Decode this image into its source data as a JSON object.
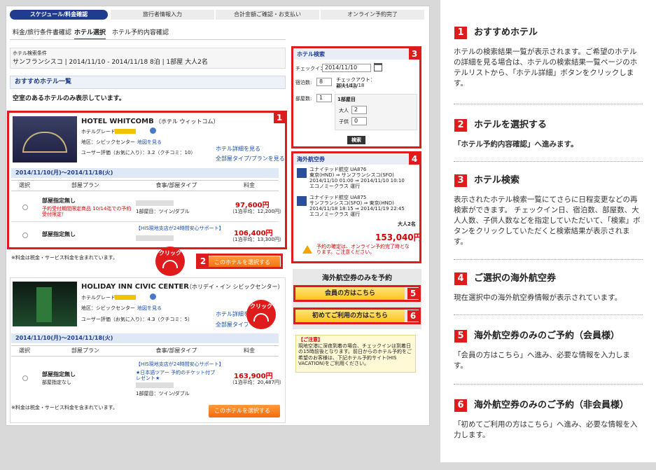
{
  "steps": [
    "スケジュール/料金確認",
    "旅行者情報入力",
    "合計金額ご確認・お支払い",
    "オンライン予約完了"
  ],
  "subtabs": [
    "料金/旅行条件書確認",
    "ホテル選択",
    "ホテル予約内容確認"
  ],
  "search_cond": {
    "label": "ホテル検索条件",
    "value": "サンフランシスコ | 2014/11/10 - 2014/11/18 8泊 | 1部屋 大人2名"
  },
  "recommend": {
    "title": "おすすめホテル一覧",
    "note": "空室のあるホテルのみ表示しています。"
  },
  "hotel1": {
    "name": "HOTEL WHITCOMB",
    "kana": "（ホテル ウィットコム）",
    "grade_label": "ホテルグレード：",
    "area": "地区：シビックセンター",
    "map_link": "地図を見る",
    "review": "ユーザー評価（お気に入り）：3.2（クチコミ：10）",
    "details_link": "ホテル詳細を見る",
    "plans_link": "全部屋タイプ/プランを見る",
    "date": "2014/11/10(月)〜2014/11/18(火)",
    "cols": [
      "選択",
      "部屋プラン",
      "食事/部屋タイプ",
      "料金"
    ],
    "rows": [
      {
        "plan": "部屋指定無し",
        "sub": "予約受付期間限定商品 10/14迄での予約受付限定！",
        "meal": "1部屋目：ツイン/ダブル",
        "price": "97,600円",
        "avg": "（1泊平均：12,200円）"
      },
      {
        "plan": "部屋指定無し",
        "sub": "",
        "meal": "【HIS現地支店が24時間安心サポート】",
        "price": "106,400円",
        "avg": "（1泊平均：13,300円）"
      }
    ],
    "tax_note": "※料金は税金・サービス料金を含まれています。",
    "select_btn": "このホテルを選択する"
  },
  "hotel2": {
    "name": "HOLIDAY INN CIVIC CENTER",
    "kana": "（ホリデイ・イン シビックセンター）",
    "grade_label": "ホテルグレード：",
    "area": "地区：シビックセンター",
    "map_link": "地図を見る",
    "review": "ユーザー評価（お気に入り）：4.3（クチコミ：5）",
    "details_link": "ホテル詳細を見る",
    "plans_link": "全部屋タイプ/プランを見る",
    "date": "2014/11/10(月)〜2014/11/18(火)",
    "cols": [
      "選択",
      "部屋プラン",
      "食事/部屋タイプ",
      "料金"
    ],
    "row": {
      "plan": "部屋指定無し",
      "sub": "部屋指定なし",
      "meal": "【HIS現地支店が24時間安心サポート】",
      "meal2": "★日本語ツアー 予約のチケット付プレゼント★",
      "meal3": "1部屋目：ツイン/ダブル",
      "price": "163,900円",
      "avg": "（1泊平均：20,487円）"
    },
    "tax_note": "※料金は税金・サービス料金を含まれています。",
    "select_btn": "このホテルを選択する"
  },
  "search_box": {
    "title": "ホテル検索",
    "checkin_label": "チェックイン:",
    "checkin_value": "2014/11/10",
    "nights_label": "宿泊数:",
    "nights_value": "8",
    "checkout": "チェックアウト： 2014/11/18",
    "checkout2": "最大14泊",
    "rooms_label": "部屋数:",
    "rooms_value": "1",
    "room1": "1部屋目",
    "adult_label": "大人",
    "adult_value": "2",
    "child_label": "子供",
    "child_value": "0",
    "search_btn": "検索"
  },
  "air": {
    "title": "海外航空券",
    "flight1": [
      "ユナイテッド航空 UA876",
      "東京(HND) ⇒ サンフランシスコ(SFO)",
      "2014/11/10 01:00 ⇒ 2014/11/10 10:10",
      "エコノミークラス 運行"
    ],
    "flight2": [
      "ユナイテッド航空 UA875",
      "サンフランシスコ(SFO) ⇒ 東京(HND)",
      "2014/11/18 18:15 ⇒ 2014/11/19 22:45",
      "エコノミークラス 運行"
    ],
    "pax": "大人2名",
    "price": "153,040円",
    "warn": "予約の確定は、オンライン予約完了時となります。ご注意ください。"
  },
  "aironly": {
    "title": "海外航空券のみを予約",
    "member_btn": "会員の方はこちら",
    "first_btn": "初めてご利用の方はこちら"
  },
  "notice": {
    "head": "【ご注意】",
    "text": "現地空港に深夜到着の場合、チェックインは到着日の15時前後となります。前日からのホテル予約をご希望のお客様は、下記ホテル予約サイト(HIS VACATION)をご利用ください。"
  },
  "click_label": "クリック",
  "markers": [
    "1",
    "2",
    "3",
    "4",
    "5",
    "6"
  ],
  "right": [
    {
      "num": "1",
      "title": "おすすめホテル",
      "desc": "ホテルの検索結果一覧が表示されます。ご希望のホテルの詳細を見る場合は、ホテルの検索結果一覧ページのホテルリストから、「ホテル詳細」ボタンをクリックします。"
    },
    {
      "num": "2",
      "title": "ホテルを選択する",
      "desc": "「ホテル予約内容確認」へ進みます。"
    },
    {
      "num": "3",
      "title": "ホテル検索",
      "desc": "表示されたホテル検索一覧にてさらに日程変更などの再検索ができます。 チェックイン日、宿泊数、部屋数、大人人数、子供人数などを指定していただいて、「検索」ボタンをクリックしていただくと検索結果が表示されます。"
    },
    {
      "num": "4",
      "title": "ご選択の海外航空券",
      "desc": "現在選択中の海外航空券情報が表示されています。"
    },
    {
      "num": "5",
      "title": "海外航空券のみのご予約（会員様）",
      "desc": "「会員の方はこちら」へ進み、必要な情報を入力します。"
    },
    {
      "num": "6",
      "title": "海外航空券のみのご予約（非会員様）",
      "desc": "「初めてご利用の方はこちら」へ進み、必要な情報を入力します。"
    }
  ],
  "colors": {
    "accent": "#e01b1b",
    "navy": "#1f3c8f",
    "orange": "#f26a0d",
    "yellow": "#ffc51c"
  }
}
